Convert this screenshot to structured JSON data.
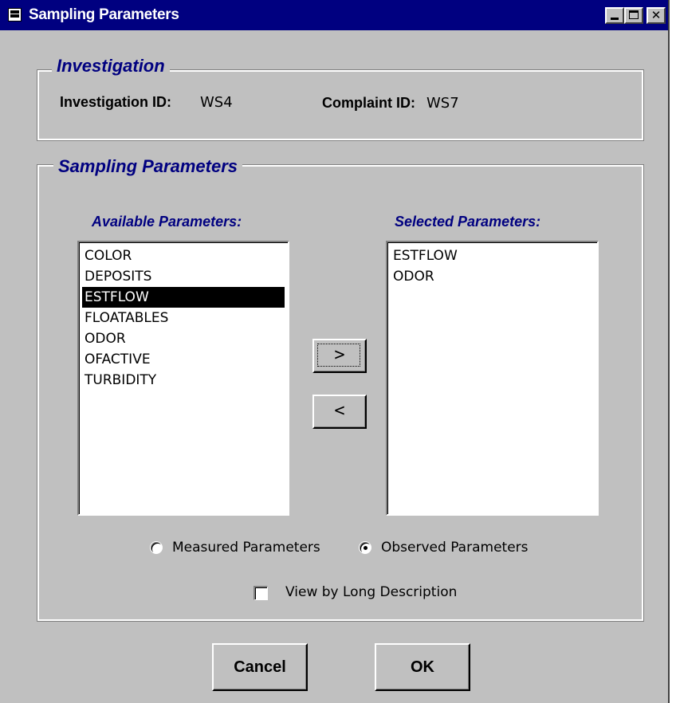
{
  "window": {
    "title": "Sampling Parameters",
    "controls": {
      "minimize": "_",
      "maximize": "□",
      "close": "✕"
    }
  },
  "investigation": {
    "group_title": "Investigation",
    "investigation_id_label": "Investigation ID:",
    "investigation_id_value": "WS4",
    "complaint_id_label": "Complaint ID:",
    "complaint_id_value": "WS7"
  },
  "sampling": {
    "group_title": "Sampling Parameters",
    "available_header": "Available Parameters:",
    "selected_header": "Selected Parameters:",
    "available_items": [
      "COLOR",
      "DEPOSITS",
      "ESTFLOW",
      "FLOATABLES",
      "ODOR",
      "OFACTIVE",
      "TURBIDITY"
    ],
    "available_selected": "ESTFLOW",
    "selected_items": [
      "ESTFLOW",
      "ODOR"
    ],
    "add_button": ">",
    "remove_button": "<",
    "radio_measured": "Measured Parameters",
    "radio_observed": "Observed Parameters",
    "radio_checked": "observed",
    "checkbox_label": "View by Long Description",
    "checkbox_checked": false
  },
  "buttons": {
    "cancel": "Cancel",
    "ok": "OK"
  },
  "colors": {
    "titlebar": "#000080",
    "face": "#c0c0c0",
    "group_title": "#000080"
  }
}
